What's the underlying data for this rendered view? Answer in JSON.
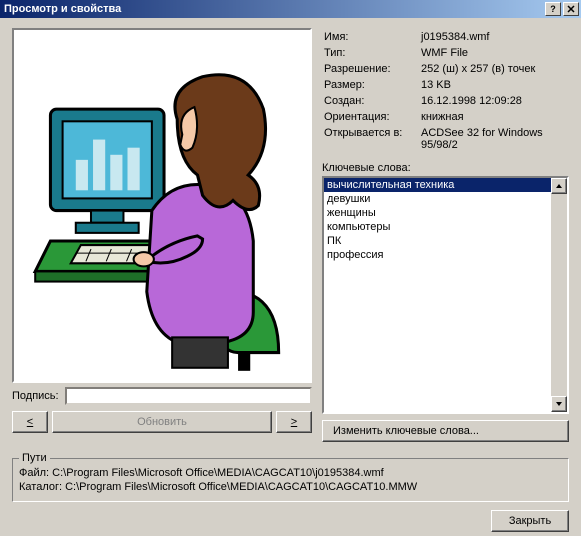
{
  "title": "Просмотр и свойства",
  "props": {
    "name_label": "Имя:",
    "name_value": "j0195384.wmf",
    "type_label": "Тип:",
    "type_value": "WMF File",
    "res_label": "Разрешение:",
    "res_value": "252 (ш) x 257 (в) точек",
    "size_label": "Размер:",
    "size_value": "13 KB",
    "created_label": "Создан:",
    "created_value": "16.12.1998 12:09:28",
    "orient_label": "Ориентация:",
    "orient_value": "книжная",
    "opens_label": "Открывается в:",
    "opens_value": "ACDSee 32 for Windows 95/98/2"
  },
  "keywords_label": "Ключевые слова:",
  "keywords": [
    "вычислительная техника",
    "девушки",
    "женщины",
    "компьютеры",
    "ПК",
    "профессия"
  ],
  "caption_label": "Подпись:",
  "buttons": {
    "prev": "<",
    "update": "Обновить",
    "next": ">",
    "edit_keywords": "Изменить ключевые слова...",
    "close": "Закрыть"
  },
  "paths": {
    "legend": "Пути",
    "file_label": "Файл:",
    "file_value": "C:\\Program Files\\Microsoft Office\\MEDIA\\CAGCAT10\\j0195384.wmf",
    "catalog_label": "Каталог:",
    "catalog_value": "C:\\Program Files\\Microsoft Office\\MEDIA\\CAGCAT10\\CAGCAT10.MMW"
  }
}
